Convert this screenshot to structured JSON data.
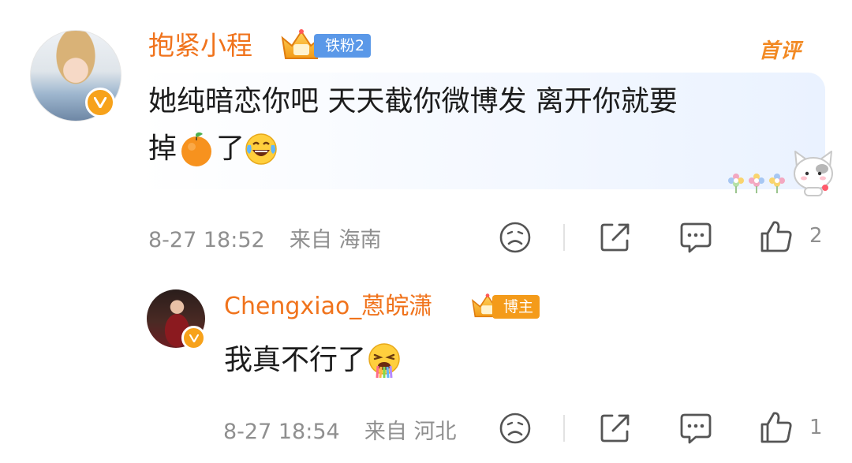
{
  "comment": {
    "username": "抱紧小程",
    "fan_badge": "铁粉2",
    "tag": "首评",
    "text_line1": "她纯暗恋你吧 天天截你微博发 离开你就要",
    "text_line2_before": "掉",
    "text_line2_after": "了",
    "emojis": [
      "tangerine-emoji",
      "laugh-cry-emoji"
    ],
    "time": "8-27 18:52",
    "location": "来自 海南",
    "like_count": "2"
  },
  "reply": {
    "username": "Chengxiao_蒽皖潇",
    "author_badge": "博主",
    "text": "我真不行了",
    "emojis": [
      "vomit-rainbow-emoji"
    ],
    "time": "8-27 18:54",
    "location": "来自 河北",
    "like_count": "1"
  },
  "icons": [
    "sad-face-icon",
    "share-icon",
    "comment-icon",
    "like-icon",
    "verified-icon",
    "crown-icon"
  ],
  "colors": {
    "username": "#f0731c",
    "fan_badge_bg": "#5a98e8",
    "author_badge_bg": "#f49b1a",
    "meta_text": "#8f8f8f",
    "verified": "#f7a21b"
  }
}
